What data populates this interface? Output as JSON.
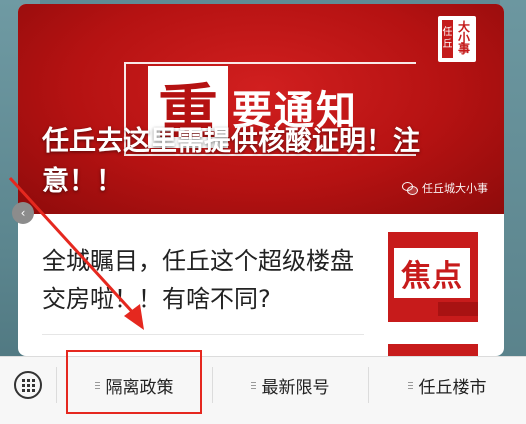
{
  "banner": {
    "notice_first_char": "重",
    "notice_rest": "要通知",
    "logo_left": "任丘",
    "logo_right": "大小事",
    "headline": "任丘去这里需提供核酸证明！注意！！",
    "source": "任丘城大小事"
  },
  "article": {
    "title": "全城瞩目，任丘这个超级楼盘交房啦！！有啥不同?",
    "thumb_text": "焦点"
  },
  "bottom_menu": {
    "items": [
      {
        "label": "隔离政策"
      },
      {
        "label": "最新限号"
      },
      {
        "label": "任丘楼市"
      }
    ]
  },
  "colors": {
    "accent_red": "#e5281f",
    "banner_red": "#b51212"
  },
  "icons": {
    "keyboard": "keyboard-icon",
    "menu": "menu-lines-icon",
    "wechat": "wechat-icon"
  }
}
